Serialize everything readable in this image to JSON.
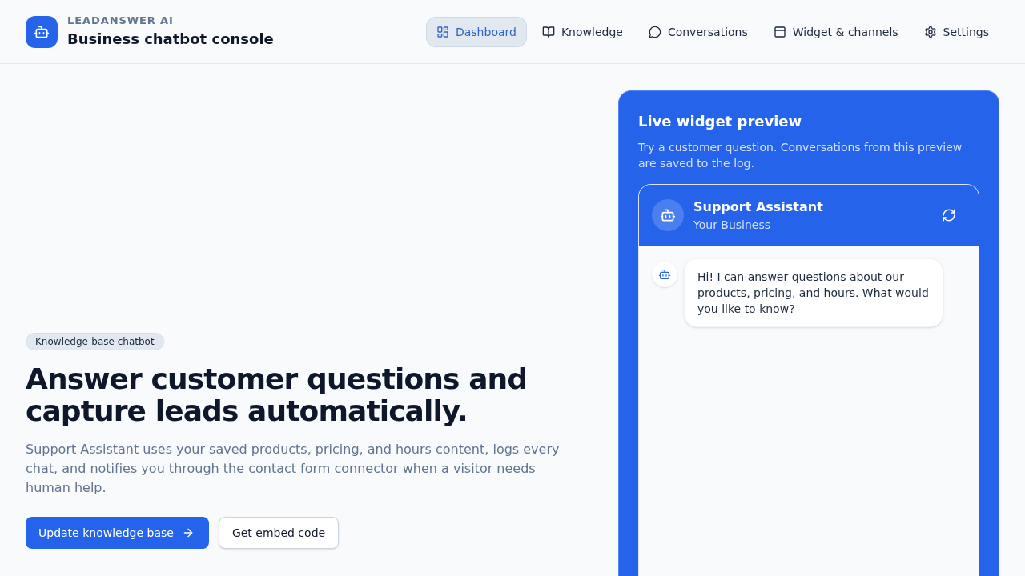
{
  "header": {
    "brand_label": "LEADANSWER AI",
    "title": "Business chatbot console"
  },
  "nav": [
    {
      "label": "Dashboard",
      "selected": true
    },
    {
      "label": "Knowledge",
      "selected": false
    },
    {
      "label": "Conversations",
      "selected": false
    },
    {
      "label": "Widget & channels",
      "selected": false
    },
    {
      "label": "Settings",
      "selected": false
    }
  ],
  "hero": {
    "tag": "Knowledge-base chatbot",
    "heading": "Answer customer questions and capture leads automatically.",
    "description": "Support Assistant uses your saved products, pricing, and hours content, logs every chat, and notifies you through the contact form connector when a visitor needs human help.",
    "buttons": [
      {
        "label": "Update knowledge base",
        "kind": "primary"
      },
      {
        "label": "Get embed code",
        "kind": "secondary"
      }
    ]
  },
  "preview": {
    "title": "Live widget preview",
    "description": "Try a customer question. Conversations from this preview are saved to the log.",
    "widget": {
      "name": "Support Assistant",
      "subtitle": "Your Business",
      "messages": [
        {
          "kind": "bot",
          "text": "Hi! I can answer questions about our products, pricing, and hours. What would you like to know?"
        }
      ]
    }
  }
}
